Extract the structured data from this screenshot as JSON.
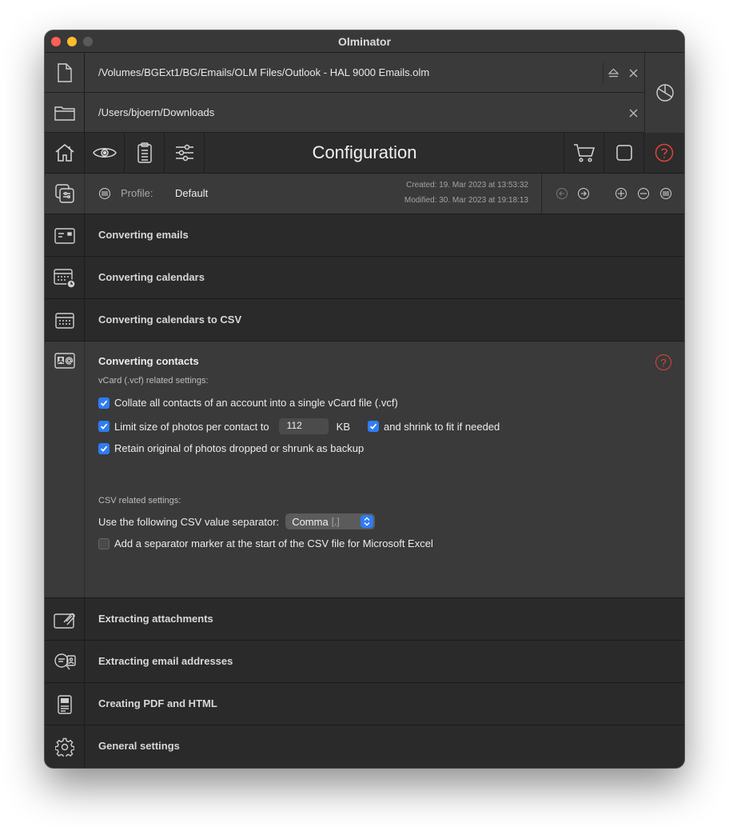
{
  "window": {
    "title": "Olminator"
  },
  "paths": {
    "source": "/Volumes/BGExt1/BG/Emails/OLM Files/Outlook - HAL 9000 Emails.olm",
    "destination": "/Users/bjoern/Downloads"
  },
  "toolbar": {
    "title": "Configuration"
  },
  "profile": {
    "label": "Profile:",
    "value": "Default",
    "created": "Created: 19. Mar 2023 at 13:53:32",
    "modified": "Modified: 30. Mar 2023 at 19:18:13"
  },
  "sections": {
    "emails": "Converting emails",
    "calendars": "Converting calendars",
    "calendars_csv": "Converting calendars to CSV",
    "contacts": "Converting contacts",
    "attachments": "Extracting attachments",
    "addresses": "Extracting email addresses",
    "pdf": "Creating PDF and HTML",
    "general": "General settings"
  },
  "contacts": {
    "vcard_heading": "vCard (.vcf) related settings:",
    "collate": {
      "label": "Collate all contacts of an account into a single vCard file (.vcf)",
      "checked": true
    },
    "limit": {
      "label": "Limit size of photos per contact to",
      "value": "112",
      "unit": "KB",
      "checked": true
    },
    "shrink": {
      "label": "and shrink to fit if needed",
      "checked": true
    },
    "retain": {
      "label": "Retain original of photos dropped or shrunk as backup",
      "checked": true
    },
    "csv_heading": "CSV related settings:",
    "separator": {
      "label": "Use the following CSV value separator:",
      "value": "Comma",
      "hint": "[,]"
    },
    "marker": {
      "label": "Add a separator marker at the start of the CSV file for Microsoft Excel",
      "checked": false
    }
  },
  "colors": {
    "accent": "#2f7cf6",
    "help": "#e0443a",
    "background": "#282828"
  }
}
